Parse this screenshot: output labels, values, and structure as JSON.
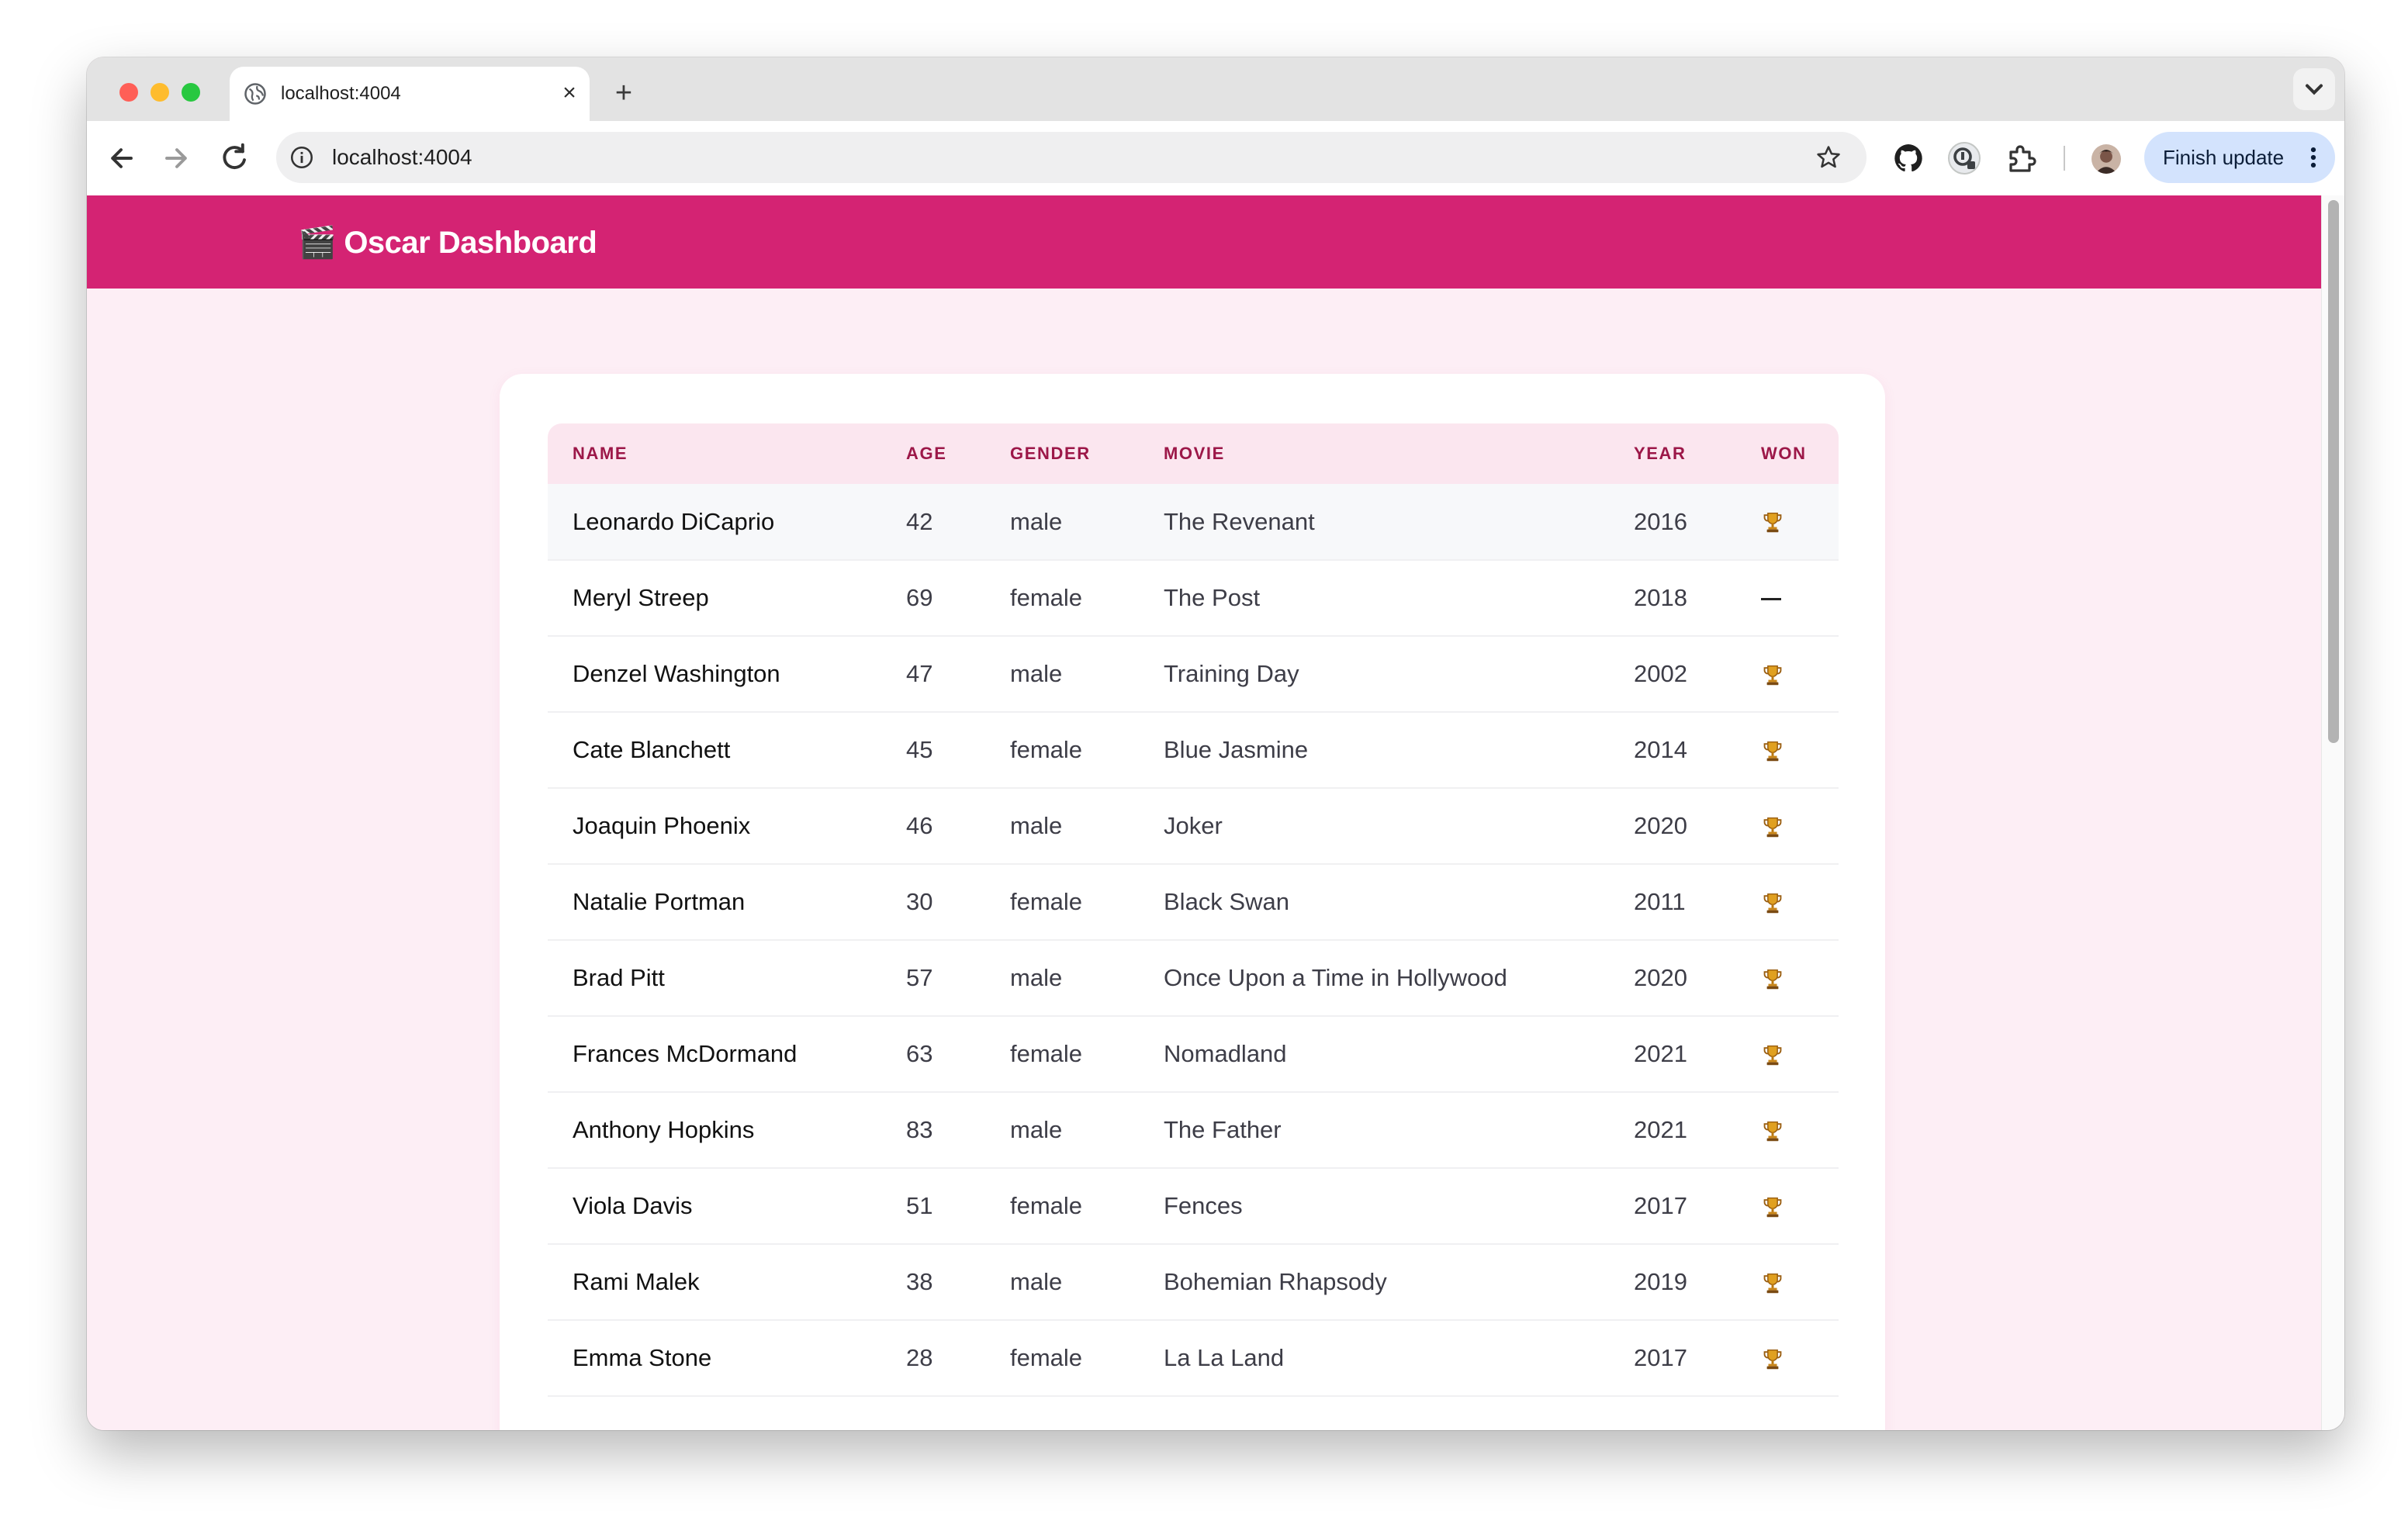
{
  "browser": {
    "tab_title": "localhost:4004",
    "url": "localhost:4004",
    "update_button_label": "Finish update",
    "traffic_lights": [
      "#ff5f57",
      "#febc2e",
      "#28c840"
    ]
  },
  "app": {
    "title": "Oscar Dashboard",
    "title_emoji": "🎬",
    "accent_color": "#d42373"
  },
  "table": {
    "columns": [
      "NAME",
      "AGE",
      "GENDER",
      "MOVIE",
      "YEAR",
      "WON"
    ],
    "rows": [
      {
        "name": "Leonardo DiCaprio",
        "age": "42",
        "gender": "male",
        "movie": "The Revenant",
        "year": "2016",
        "won": true
      },
      {
        "name": "Meryl Streep",
        "age": "69",
        "gender": "female",
        "movie": "The Post",
        "year": "2018",
        "won": false
      },
      {
        "name": "Denzel Washington",
        "age": "47",
        "gender": "male",
        "movie": "Training Day",
        "year": "2002",
        "won": true
      },
      {
        "name": "Cate Blanchett",
        "age": "45",
        "gender": "female",
        "movie": "Blue Jasmine",
        "year": "2014",
        "won": true
      },
      {
        "name": "Joaquin Phoenix",
        "age": "46",
        "gender": "male",
        "movie": "Joker",
        "year": "2020",
        "won": true
      },
      {
        "name": "Natalie Portman",
        "age": "30",
        "gender": "female",
        "movie": "Black Swan",
        "year": "2011",
        "won": true
      },
      {
        "name": "Brad Pitt",
        "age": "57",
        "gender": "male",
        "movie": "Once Upon a Time in Hollywood",
        "year": "2020",
        "won": true
      },
      {
        "name": "Frances McDormand",
        "age": "63",
        "gender": "female",
        "movie": "Nomadland",
        "year": "2021",
        "won": true
      },
      {
        "name": "Anthony Hopkins",
        "age": "83",
        "gender": "male",
        "movie": "The Father",
        "year": "2021",
        "won": true
      },
      {
        "name": "Viola Davis",
        "age": "51",
        "gender": "female",
        "movie": "Fences",
        "year": "2017",
        "won": true
      },
      {
        "name": "Rami Malek",
        "age": "38",
        "gender": "male",
        "movie": "Bohemian Rhapsody",
        "year": "2019",
        "won": true
      },
      {
        "name": "Emma Stone",
        "age": "28",
        "gender": "female",
        "movie": "La La Land",
        "year": "2017",
        "won": true
      }
    ]
  }
}
